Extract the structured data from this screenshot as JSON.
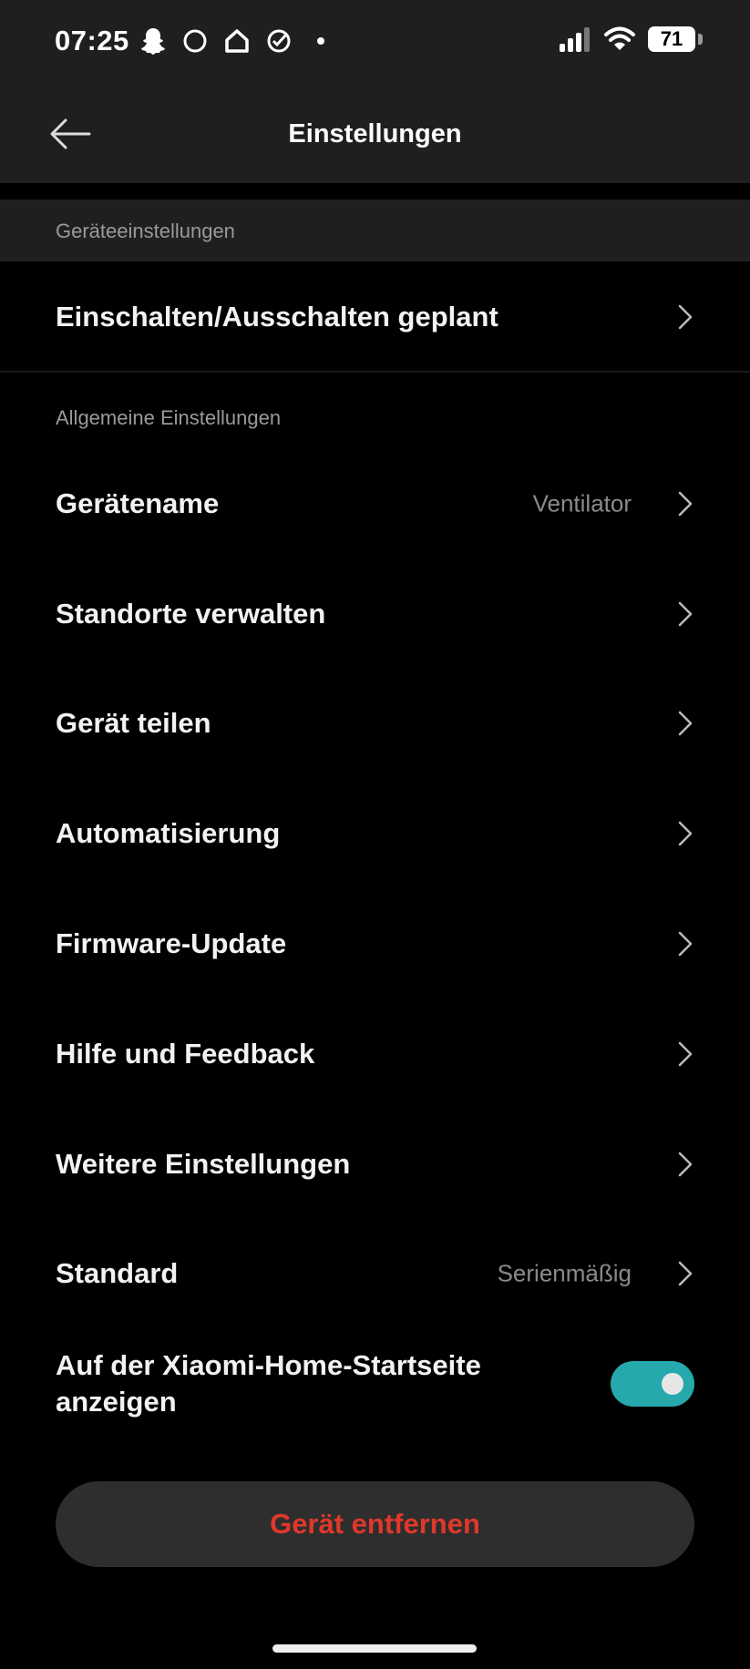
{
  "status_bar": {
    "time": "07:25",
    "left_icons": [
      "snapchat-icon",
      "circle-icon",
      "home-icon",
      "check-circle-icon",
      "dot-icon"
    ],
    "battery": "71"
  },
  "header": {
    "title": "Einstellungen"
  },
  "sections": {
    "device_settings": {
      "heading": "Geräteeinstellungen",
      "items": [
        {
          "label": "Einschalten/Ausschalten geplant"
        }
      ]
    },
    "general_settings": {
      "heading": "Allgemeine Einstellungen",
      "items": [
        {
          "label": "Gerätename",
          "value": "Ventilator"
        },
        {
          "label": "Standorte verwalten"
        },
        {
          "label": "Gerät teilen"
        },
        {
          "label": "Automatisierung"
        },
        {
          "label": "Firmware-Update"
        },
        {
          "label": "Hilfe und Feedback"
        },
        {
          "label": "Weitere Einstellungen"
        },
        {
          "label": "Standard",
          "value": "Serienmäßig"
        }
      ]
    }
  },
  "toggle": {
    "line1": "Auf der Xiaomi-Home-Startseite",
    "line2": "anzeigen",
    "enabled": true,
    "accent_color": "#25a9ad"
  },
  "remove_button": {
    "label": "Gerät entfernen",
    "color": "#e0382a"
  }
}
